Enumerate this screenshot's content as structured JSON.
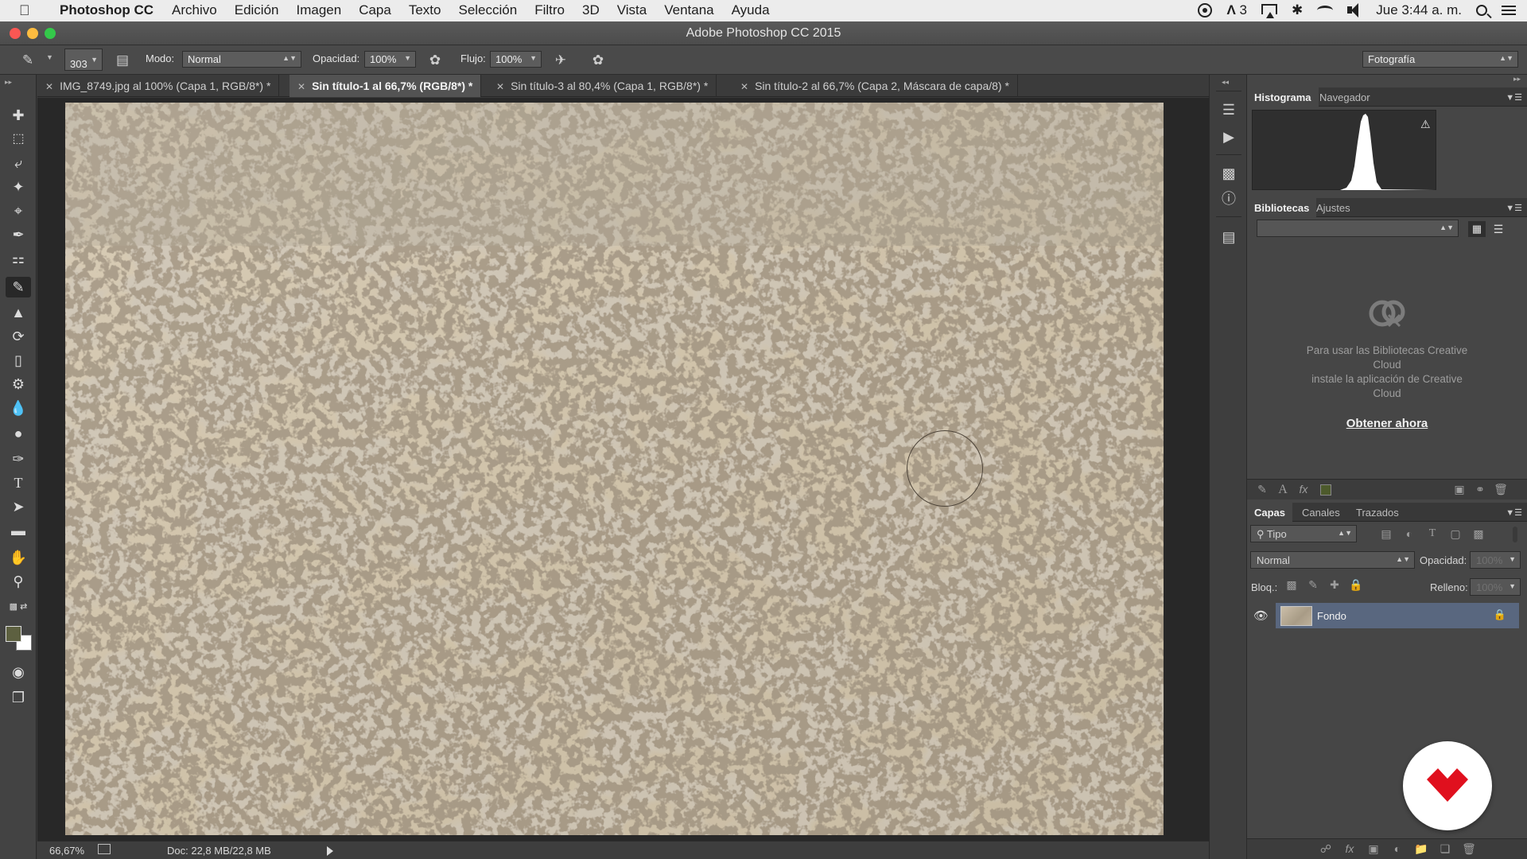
{
  "menubar": {
    "app": "Photoshop CC",
    "items": [
      "Archivo",
      "Edición",
      "Imagen",
      "Capa",
      "Texto",
      "Selección",
      "Filtro",
      "3D",
      "Vista",
      "Ventana",
      "Ayuda"
    ],
    "adobe_badge": "3",
    "clock": "Jue 3:44 a. m."
  },
  "window": {
    "title": "Adobe Photoshop CC 2015"
  },
  "options": {
    "brush_size": "303",
    "mode_label": "Modo:",
    "mode_value": "Normal",
    "opacity_label": "Opacidad:",
    "opacity_value": "100%",
    "flow_label": "Flujo:",
    "flow_value": "100%",
    "workspace": "Fotografía"
  },
  "tabs": [
    {
      "label": "IMG_8749.jpg al 100% (Capa 1, RGB/8*) *",
      "active": false
    },
    {
      "label": "Sin título-1 al 66,7% (RGB/8*) *",
      "active": true
    },
    {
      "label": "Sin título-3 al 80,4% (Capa 1, RGB/8*) *",
      "active": false
    },
    {
      "label": "Sin título-2 al 66,7% (Capa 2, Máscara de capa/8) *",
      "active": false
    }
  ],
  "status": {
    "zoom": "66,67%",
    "doc": "Doc: 22,8 MB/22,8 MB"
  },
  "panels": {
    "top_tabs": [
      "Histograma",
      "Navegador"
    ],
    "lib_tabs": [
      "Bibliotecas",
      "Ajustes"
    ],
    "lib_msg_1": "Para usar las Bibliotecas Creative",
    "lib_msg_2": "Cloud",
    "lib_msg_3": "instale la aplicación de Creative",
    "lib_msg_4": "Cloud",
    "lib_cta": "Obtener ahora",
    "layer_tabs": [
      "Capas",
      "Canales",
      "Trazados"
    ],
    "filter_value": "Tipo",
    "blend_value": "Normal",
    "opacity_label": "Opacidad:",
    "opacity_value": "100%",
    "lock_label": "Bloq.:",
    "fill_label": "Relleno:",
    "fill_value": "100%"
  },
  "layers": [
    {
      "name": "Fondo",
      "selected": true,
      "visible": true,
      "locked": true
    }
  ],
  "colors": {
    "foreground": "#5d6040",
    "background": "#ffffff",
    "selection": "#59677f",
    "watermark": "#e0101e"
  },
  "icons": {
    "tools": [
      "move-icon",
      "marquee-icon",
      "lasso-icon",
      "magic-wand-icon",
      "crop-icon",
      "eyedropper-icon",
      "healing-brush-icon",
      "brush-icon",
      "stamp-icon",
      "history-brush-icon",
      "eraser-icon",
      "paint-bucket-icon",
      "blur-icon",
      "dodge-icon",
      "pen-icon",
      "type-icon",
      "path-selection-icon",
      "rectangle-icon",
      "hand-icon",
      "zoom-icon",
      "quick-mask-icon",
      "screen-mode-icon"
    ]
  }
}
